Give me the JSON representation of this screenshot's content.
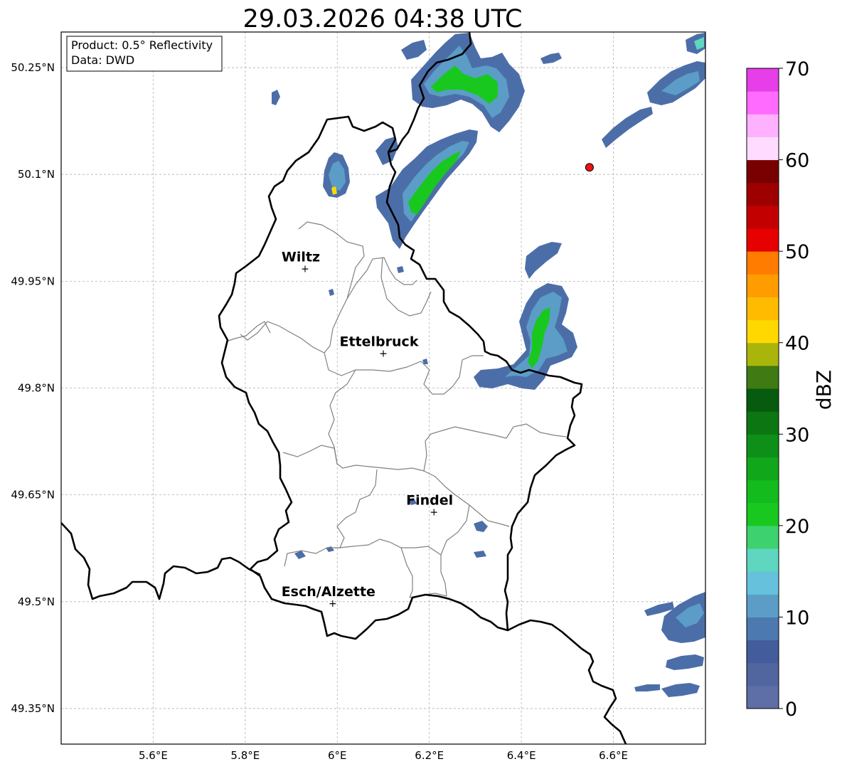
{
  "map": {
    "title": "29.03.2026 04:38 UTC",
    "lon_range": [
      5.4,
      6.8
    ],
    "lat_range": [
      49.3,
      50.3
    ],
    "lon_ticks": [
      {
        "value": 5.6,
        "label": "5.6°E"
      },
      {
        "value": 5.8,
        "label": "5.8°E"
      },
      {
        "value": 6.0,
        "label": "6°E"
      },
      {
        "value": 6.2,
        "label": "6.2°E"
      },
      {
        "value": 6.4,
        "label": "6.4°E"
      },
      {
        "value": 6.6,
        "label": "6.6°E"
      }
    ],
    "lat_ticks": [
      {
        "value": 50.25,
        "label": "50.25°N"
      },
      {
        "value": 50.1,
        "label": "50.1°N"
      },
      {
        "value": 49.95,
        "label": "49.95°N"
      },
      {
        "value": 49.8,
        "label": "49.8°N"
      },
      {
        "value": 49.65,
        "label": "49.65°N"
      },
      {
        "value": 49.5,
        "label": "49.5°N"
      },
      {
        "value": 49.35,
        "label": "49.35°N"
      }
    ],
    "gridlines": true,
    "info_box": {
      "line1": "Product: 0.5° Reflectivity",
      "line2": "Data: DWD",
      "placement": "top-left"
    },
    "cities": [
      {
        "name": "Wiltz",
        "lon": 5.93,
        "lat": 49.968
      },
      {
        "name": "Ettelbruck",
        "lon": 6.1,
        "lat": 49.849
      },
      {
        "name": "Findel",
        "lon": 6.21,
        "lat": 49.626
      },
      {
        "name": "Esch/Alzette",
        "lon": 5.99,
        "lat": 49.498
      }
    ],
    "radar_site_marker": {
      "lon": 6.548,
      "lat": 50.11,
      "color": "#ee1111"
    },
    "colorbar": {
      "label": "dBZ",
      "min": 0,
      "max": 70,
      "ticks": [
        {
          "value": 0,
          "label": "0"
        },
        {
          "value": 10,
          "label": "10"
        },
        {
          "value": 20,
          "label": "20"
        },
        {
          "value": 30,
          "label": "30"
        },
        {
          "value": 40,
          "label": "40"
        },
        {
          "value": 50,
          "label": "50"
        },
        {
          "value": 60,
          "label": "60"
        },
        {
          "value": 70,
          "label": "70"
        }
      ],
      "colors": [
        "#5e6ea6",
        "#51659f",
        "#435c9c",
        "#4c79b0",
        "#5b9dc7",
        "#66c2dc",
        "#5ed6c0",
        "#3ed16f",
        "#18c81f",
        "#13bb1d",
        "#10a71a",
        "#0e8f17",
        "#0b7612",
        "#075b0e",
        "#3f7a12",
        "#aab50c",
        "#ffd800",
        "#ffbb00",
        "#ff9c00",
        "#ff7c00",
        "#e60000",
        "#c20000",
        "#9e0000",
        "#780000",
        "#ffdcff",
        "#ffb1ff",
        "#ff6bff",
        "#e63ee8"
      ]
    },
    "echo_colors": {
      "weak": "#4c6ea8",
      "light": "#5b9dc7",
      "cyan": "#5ed6c0",
      "green": "#18c81f",
      "yellow": "#ffd800"
    }
  }
}
